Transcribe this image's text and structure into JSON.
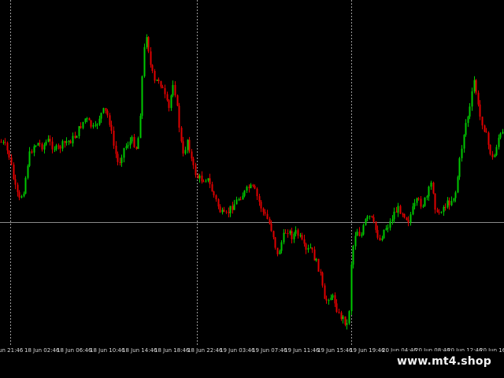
{
  "chart_data": {
    "type": "candlestick",
    "title": "",
    "ylim": [
      0,
      450
    ],
    "horizontal_level": 282,
    "colors": {
      "bull": "#00c800",
      "bear": "#e00000",
      "grid": "#9a9a9a",
      "level": "#8a8a8a",
      "background": "#000000"
    },
    "time_labels": [
      "18 Jun 02:46",
      "18 Jun 06:46",
      "18 Jun 10:46",
      "18 Jun 14:46",
      "18 Jun 18:46",
      "18 Jun 22:46",
      "19 Jun 03:46",
      "19 Jun 07:46",
      "19 Jun 11:46",
      "19 Jun 15:46",
      "19 Jun 19:46",
      "20 Jun 04:46",
      "20 Jun 08:46",
      "20 Jun 12:46",
      "20 Jun 16:46"
    ],
    "left_partial_label": "Jun 21:46",
    "vertical_separators": [
      13,
      250,
      446
    ],
    "path": [
      [
        0,
        180
      ],
      [
        6,
        185
      ],
      [
        12,
        200
      ],
      [
        18,
        235
      ],
      [
        24,
        255
      ],
      [
        30,
        240
      ],
      [
        36,
        200
      ],
      [
        42,
        185
      ],
      [
        48,
        182
      ],
      [
        54,
        186
      ],
      [
        60,
        178
      ],
      [
        66,
        185
      ],
      [
        72,
        190
      ],
      [
        78,
        185
      ],
      [
        84,
        180
      ],
      [
        90,
        178
      ],
      [
        96,
        172
      ],
      [
        102,
        160
      ],
      [
        108,
        150
      ],
      [
        114,
        158
      ],
      [
        120,
        165
      ],
      [
        126,
        148
      ],
      [
        132,
        140
      ],
      [
        138,
        150
      ],
      [
        144,
        185
      ],
      [
        150,
        210
      ],
      [
        156,
        190
      ],
      [
        162,
        182
      ],
      [
        168,
        178
      ],
      [
        174,
        190
      ],
      [
        178,
        140
      ],
      [
        182,
        70
      ],
      [
        186,
        40
      ],
      [
        190,
        80
      ],
      [
        196,
        105
      ],
      [
        202,
        100
      ],
      [
        208,
        120
      ],
      [
        214,
        140
      ],
      [
        220,
        100
      ],
      [
        226,
        150
      ],
      [
        232,
        200
      ],
      [
        238,
        175
      ],
      [
        244,
        210
      ],
      [
        250,
        225
      ],
      [
        256,
        228
      ],
      [
        262,
        225
      ],
      [
        268,
        240
      ],
      [
        274,
        255
      ],
      [
        280,
        270
      ],
      [
        286,
        275
      ],
      [
        292,
        265
      ],
      [
        298,
        258
      ],
      [
        304,
        250
      ],
      [
        310,
        245
      ],
      [
        316,
        238
      ],
      [
        322,
        240
      ],
      [
        328,
        255
      ],
      [
        334,
        270
      ],
      [
        340,
        280
      ],
      [
        346,
        295
      ],
      [
        352,
        325
      ],
      [
        358,
        305
      ],
      [
        364,
        290
      ],
      [
        370,
        300
      ],
      [
        376,
        295
      ],
      [
        382,
        305
      ],
      [
        388,
        320
      ],
      [
        394,
        315
      ],
      [
        400,
        330
      ],
      [
        406,
        345
      ],
      [
        412,
        385
      ],
      [
        418,
        375
      ],
      [
        424,
        380
      ],
      [
        430,
        400
      ],
      [
        436,
        405
      ],
      [
        442,
        415
      ],
      [
        446,
        325
      ],
      [
        452,
        290
      ],
      [
        458,
        300
      ],
      [
        464,
        280
      ],
      [
        470,
        275
      ],
      [
        476,
        290
      ],
      [
        482,
        305
      ],
      [
        488,
        290
      ],
      [
        494,
        285
      ],
      [
        500,
        270
      ],
      [
        506,
        265
      ],
      [
        512,
        270
      ],
      [
        518,
        280
      ],
      [
        524,
        265
      ],
      [
        530,
        255
      ],
      [
        536,
        260
      ],
      [
        542,
        250
      ],
      [
        548,
        230
      ],
      [
        554,
        275
      ],
      [
        560,
        265
      ],
      [
        566,
        260
      ],
      [
        572,
        255
      ],
      [
        578,
        245
      ],
      [
        584,
        200
      ],
      [
        590,
        160
      ],
      [
        596,
        140
      ],
      [
        602,
        100
      ],
      [
        608,
        145
      ],
      [
        614,
        160
      ],
      [
        620,
        185
      ],
      [
        626,
        205
      ],
      [
        632,
        175
      ],
      [
        638,
        170
      ]
    ]
  },
  "watermark": {
    "text": "www.mt4.shop"
  }
}
